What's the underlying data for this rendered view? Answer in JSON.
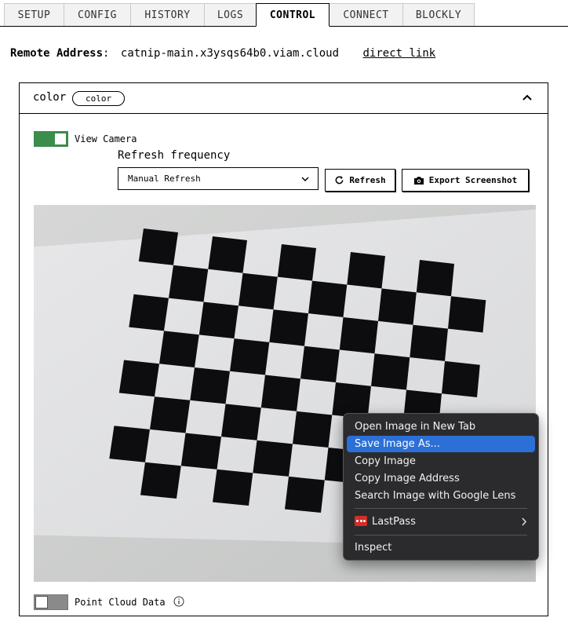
{
  "tabs": [
    {
      "label": "SETUP"
    },
    {
      "label": "CONFIG"
    },
    {
      "label": "HISTORY"
    },
    {
      "label": "LOGS"
    },
    {
      "label": "CONTROL",
      "active": true
    },
    {
      "label": "CONNECT"
    },
    {
      "label": "BLOCKLY"
    }
  ],
  "remote": {
    "label": "Remote Address",
    "separator": ":",
    "address": "catnip-main.x3ysqs64b0.viam.cloud",
    "link": "direct link"
  },
  "card": {
    "title": "color",
    "badge": "color",
    "view_camera": {
      "label": "View Camera",
      "on": true
    },
    "refresh_frequency": {
      "label": "Refresh frequency",
      "selected": "Manual Refresh"
    },
    "refresh_button": "Refresh",
    "export_button": "Export Screenshot",
    "point_cloud": {
      "label": "Point Cloud Data",
      "on": false
    }
  },
  "context_menu": {
    "items": [
      {
        "label": "Open Image in New Tab"
      },
      {
        "label": "Save Image As...",
        "highlighted": true
      },
      {
        "label": "Copy Image"
      },
      {
        "label": "Copy Image Address"
      },
      {
        "label": "Search Image with Google Lens"
      },
      {
        "label": "LastPass",
        "submenu": true
      },
      {
        "label": "Inspect"
      }
    ]
  },
  "colors": {
    "toggle_on": "#3a8d4a",
    "menu_bg": "#2b2b2e",
    "menu_highlight": "#2c6fd6",
    "lastpass_red": "#d32d27"
  },
  "icons": {
    "collapse": "chevron-up-icon",
    "dropdown": "chevron-down-icon",
    "refresh": "refresh-icon",
    "export": "camera-icon",
    "info": "info-icon",
    "lastpass": "lastpass-icon",
    "submenu": "chevron-right-icon"
  }
}
